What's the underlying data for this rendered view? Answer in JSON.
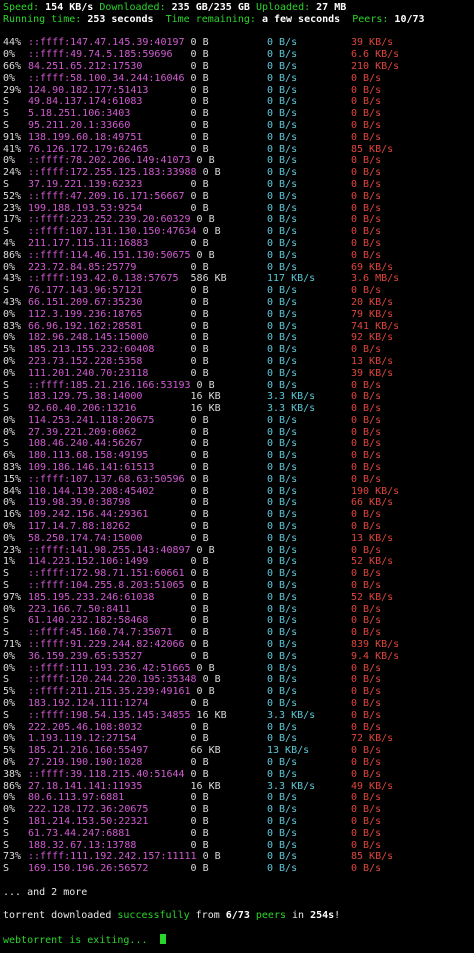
{
  "status": {
    "speed_label": "Speed:",
    "speed_value": "154 KB/s",
    "downloaded_label": "Downloaded:",
    "downloaded_value": "235 GB/235 GB",
    "uploaded_label": "Uploaded:",
    "uploaded_value": "27 MB",
    "running_label": "Running time:",
    "running_value": "253 seconds",
    "remaining_label": "Time remaining:",
    "remaining_value": "a few seconds",
    "peers_label": "Peers:",
    "peers_value": "10/73"
  },
  "peers": [
    {
      "progress": "44%",
      "address": "::ffff:147.47.145.39:40197",
      "downloaded": "0 B",
      "down_speed": "0 B/s",
      "up_speed": "39 KB/s"
    },
    {
      "progress": "0%",
      "address": "::ffff:49.74.5.185:59696",
      "downloaded": "0 B",
      "down_speed": "0 B/s",
      "up_speed": "6.6 KB/s"
    },
    {
      "progress": "66%",
      "address": "84.251.65.212:17530",
      "downloaded": "0 B",
      "down_speed": "0 B/s",
      "up_speed": "210 KB/s"
    },
    {
      "progress": "0%",
      "address": "::ffff:58.100.34.244:16046",
      "downloaded": "0 B",
      "down_speed": "0 B/s",
      "up_speed": "0 B/s"
    },
    {
      "progress": "29%",
      "address": "124.90.182.177:51413",
      "downloaded": "0 B",
      "down_speed": "0 B/s",
      "up_speed": "0 B/s"
    },
    {
      "progress": "S",
      "address": "49.84.137.174:61083",
      "downloaded": "0 B",
      "down_speed": "0 B/s",
      "up_speed": "0 B/s"
    },
    {
      "progress": "S",
      "address": "5.18.251.106:3403",
      "downloaded": "0 B",
      "down_speed": "0 B/s",
      "up_speed": "0 B/s"
    },
    {
      "progress": "S",
      "address": "95.211.20.1:33660",
      "downloaded": "0 B",
      "down_speed": "0 B/s",
      "up_speed": "0 B/s"
    },
    {
      "progress": "91%",
      "address": "138.199.60.18:49751",
      "downloaded": "0 B",
      "down_speed": "0 B/s",
      "up_speed": "0 B/s"
    },
    {
      "progress": "41%",
      "address": "76.126.172.179:62465",
      "downloaded": "0 B",
      "down_speed": "0 B/s",
      "up_speed": "85 KB/s"
    },
    {
      "progress": "0%",
      "address": "::ffff:78.202.206.149:41073",
      "downloaded": "0 B",
      "down_speed": "0 B/s",
      "up_speed": "0 B/s"
    },
    {
      "progress": "24%",
      "address": "::ffff:172.255.125.183:33988",
      "downloaded": "0 B",
      "down_speed": "0 B/s",
      "up_speed": "0 B/s"
    },
    {
      "progress": "S",
      "address": "37.19.221.139:62323",
      "downloaded": "0 B",
      "down_speed": "0 B/s",
      "up_speed": "0 B/s"
    },
    {
      "progress": "52%",
      "address": "::ffff:47.209.16.171:56667",
      "downloaded": "0 B",
      "down_speed": "0 B/s",
      "up_speed": "0 B/s"
    },
    {
      "progress": "23%",
      "address": "199.188.193.53:9254",
      "downloaded": "0 B",
      "down_speed": "0 B/s",
      "up_speed": "0 B/s"
    },
    {
      "progress": "17%",
      "address": "::ffff:223.252.239.20:60329",
      "downloaded": "0 B",
      "down_speed": "0 B/s",
      "up_speed": "0 B/s"
    },
    {
      "progress": "S",
      "address": "::ffff:107.131.130.150:47634",
      "downloaded": "0 B",
      "down_speed": "0 B/s",
      "up_speed": "0 B/s"
    },
    {
      "progress": "4%",
      "address": "211.177.115.11:16883",
      "downloaded": "0 B",
      "down_speed": "0 B/s",
      "up_speed": "0 B/s"
    },
    {
      "progress": "86%",
      "address": "::ffff:114.46.151.130:50675",
      "downloaded": "0 B",
      "down_speed": "0 B/s",
      "up_speed": "0 B/s"
    },
    {
      "progress": "0%",
      "address": "223.72.84.85:25779",
      "downloaded": "0 B",
      "down_speed": "0 B/s",
      "up_speed": "69 KB/s"
    },
    {
      "progress": "43%",
      "address": "::ffff:193.42.0.138:57675",
      "downloaded": "586 KB",
      "down_speed": "117 KB/s",
      "up_speed": "3.6 MB/s"
    },
    {
      "progress": "S",
      "address": "76.177.143.96:57121",
      "downloaded": "0 B",
      "down_speed": "0 B/s",
      "up_speed": "0 B/s"
    },
    {
      "progress": "43%",
      "address": "66.151.209.67:35230",
      "downloaded": "0 B",
      "down_speed": "0 B/s",
      "up_speed": "20 KB/s"
    },
    {
      "progress": "0%",
      "address": "112.3.199.236:18765",
      "downloaded": "0 B",
      "down_speed": "0 B/s",
      "up_speed": "79 KB/s"
    },
    {
      "progress": "83%",
      "address": "66.96.192.162:28581",
      "downloaded": "0 B",
      "down_speed": "0 B/s",
      "up_speed": "741 KB/s"
    },
    {
      "progress": "0%",
      "address": "182.96.248.145:15000",
      "downloaded": "0 B",
      "down_speed": "0 B/s",
      "up_speed": "92 KB/s"
    },
    {
      "progress": "5%",
      "address": "185.213.155.232:60408",
      "downloaded": "0 B",
      "down_speed": "0 B/s",
      "up_speed": "0 B/s"
    },
    {
      "progress": "0%",
      "address": "223.73.152.228:5358",
      "downloaded": "0 B",
      "down_speed": "0 B/s",
      "up_speed": "13 KB/s"
    },
    {
      "progress": "0%",
      "address": "111.201.240.70:23118",
      "downloaded": "0 B",
      "down_speed": "0 B/s",
      "up_speed": "39 KB/s"
    },
    {
      "progress": "S",
      "address": "::ffff:185.21.216.166:53193",
      "downloaded": "0 B",
      "down_speed": "0 B/s",
      "up_speed": "0 B/s"
    },
    {
      "progress": "S",
      "address": "183.129.75.38:14000",
      "downloaded": "16 KB",
      "down_speed": "3.3 KB/s",
      "up_speed": "0 B/s"
    },
    {
      "progress": "S",
      "address": "92.60.40.206:13216",
      "downloaded": "16 KB",
      "down_speed": "3.3 KB/s",
      "up_speed": "0 B/s"
    },
    {
      "progress": "0%",
      "address": "114.253.241.118:20675",
      "downloaded": "0 B",
      "down_speed": "0 B/s",
      "up_speed": "0 B/s"
    },
    {
      "progress": "0%",
      "address": "27.39.221.209:6062",
      "downloaded": "0 B",
      "down_speed": "0 B/s",
      "up_speed": "0 B/s"
    },
    {
      "progress": "S",
      "address": "108.46.240.44:56267",
      "downloaded": "0 B",
      "down_speed": "0 B/s",
      "up_speed": "0 B/s"
    },
    {
      "progress": "6%",
      "address": "180.113.68.158:49195",
      "downloaded": "0 B",
      "down_speed": "0 B/s",
      "up_speed": "0 B/s"
    },
    {
      "progress": "83%",
      "address": "109.186.146.141:61513",
      "downloaded": "0 B",
      "down_speed": "0 B/s",
      "up_speed": "0 B/s"
    },
    {
      "progress": "15%",
      "address": "::ffff:107.137.68.63:50596",
      "downloaded": "0 B",
      "down_speed": "0 B/s",
      "up_speed": "0 B/s"
    },
    {
      "progress": "84%",
      "address": "110.144.139.208:45402",
      "downloaded": "0 B",
      "down_speed": "0 B/s",
      "up_speed": "190 KB/s"
    },
    {
      "progress": "0%",
      "address": "119.98.39.0:38798",
      "downloaded": "0 B",
      "down_speed": "0 B/s",
      "up_speed": "66 KB/s"
    },
    {
      "progress": "16%",
      "address": "109.242.156.44:29361",
      "downloaded": "0 B",
      "down_speed": "0 B/s",
      "up_speed": "0 B/s"
    },
    {
      "progress": "0%",
      "address": "117.14.7.88:18262",
      "downloaded": "0 B",
      "down_speed": "0 B/s",
      "up_speed": "0 B/s"
    },
    {
      "progress": "0%",
      "address": "58.250.174.74:15000",
      "downloaded": "0 B",
      "down_speed": "0 B/s",
      "up_speed": "13 KB/s"
    },
    {
      "progress": "23%",
      "address": "::ffff:141.98.255.143:40897",
      "downloaded": "0 B",
      "down_speed": "0 B/s",
      "up_speed": "0 B/s"
    },
    {
      "progress": "1%",
      "address": "114.223.152.106:1499",
      "downloaded": "0 B",
      "down_speed": "0 B/s",
      "up_speed": "52 KB/s"
    },
    {
      "progress": "S",
      "address": "::ffff:172.98.71.151:60661",
      "downloaded": "0 B",
      "down_speed": "0 B/s",
      "up_speed": "0 B/s"
    },
    {
      "progress": "S",
      "address": "::ffff:104.255.8.203:51065",
      "downloaded": "0 B",
      "down_speed": "0 B/s",
      "up_speed": "0 B/s"
    },
    {
      "progress": "97%",
      "address": "185.195.233.246:61038",
      "downloaded": "0 B",
      "down_speed": "0 B/s",
      "up_speed": "52 KB/s"
    },
    {
      "progress": "0%",
      "address": "223.166.7.50:8411",
      "downloaded": "0 B",
      "down_speed": "0 B/s",
      "up_speed": "0 B/s"
    },
    {
      "progress": "S",
      "address": "61.140.232.182:58468",
      "downloaded": "0 B",
      "down_speed": "0 B/s",
      "up_speed": "0 B/s"
    },
    {
      "progress": "S",
      "address": "::ffff:45.160.74.7:35071",
      "downloaded": "0 B",
      "down_speed": "0 B/s",
      "up_speed": "0 B/s"
    },
    {
      "progress": "71%",
      "address": "::ffff:91.229.244.82:42066",
      "downloaded": "0 B",
      "down_speed": "0 B/s",
      "up_speed": "839 KB/s"
    },
    {
      "progress": "0%",
      "address": "36.159.239.65:53527",
      "downloaded": "0 B",
      "down_speed": "0 B/s",
      "up_speed": "9.4 KB/s"
    },
    {
      "progress": "0%",
      "address": "::ffff:111.193.236.42:51665",
      "downloaded": "0 B",
      "down_speed": "0 B/s",
      "up_speed": "0 B/s"
    },
    {
      "progress": "S",
      "address": "::ffff:120.244.220.195:35348",
      "downloaded": "0 B",
      "down_speed": "0 B/s",
      "up_speed": "0 B/s"
    },
    {
      "progress": "5%",
      "address": "::ffff:211.215.35.239:49161",
      "downloaded": "0 B",
      "down_speed": "0 B/s",
      "up_speed": "0 B/s"
    },
    {
      "progress": "0%",
      "address": "183.192.124.111:1274",
      "downloaded": "0 B",
      "down_speed": "0 B/s",
      "up_speed": "0 B/s"
    },
    {
      "progress": "S",
      "address": "::ffff:198.54.135.145:34855",
      "downloaded": "16 KB",
      "down_speed": "3.3 KB/s",
      "up_speed": "0 B/s"
    },
    {
      "progress": "0%",
      "address": "222.205.46.108:8032",
      "downloaded": "0 B",
      "down_speed": "0 B/s",
      "up_speed": "0 B/s"
    },
    {
      "progress": "0%",
      "address": "1.193.119.12:27154",
      "downloaded": "0 B",
      "down_speed": "0 B/s",
      "up_speed": "72 KB/s"
    },
    {
      "progress": "5%",
      "address": "185.21.216.160:55497",
      "downloaded": "66 KB",
      "down_speed": "13 KB/s",
      "up_speed": "0 B/s"
    },
    {
      "progress": "0%",
      "address": "27.219.190.190:1028",
      "downloaded": "0 B",
      "down_speed": "0 B/s",
      "up_speed": "0 B/s"
    },
    {
      "progress": "38%",
      "address": "::ffff:39.118.215.40:51644",
      "downloaded": "0 B",
      "down_speed": "0 B/s",
      "up_speed": "0 B/s"
    },
    {
      "progress": "86%",
      "address": "27.18.141.141:11935",
      "downloaded": "16 KB",
      "down_speed": "3.3 KB/s",
      "up_speed": "49 KB/s"
    },
    {
      "progress": "0%",
      "address": "80.6.113.97:6881",
      "downloaded": "0 B",
      "down_speed": "0 B/s",
      "up_speed": "0 B/s"
    },
    {
      "progress": "0%",
      "address": "222.128.172.36:20675",
      "downloaded": "0 B",
      "down_speed": "0 B/s",
      "up_speed": "0 B/s"
    },
    {
      "progress": "S",
      "address": "181.214.153.50:22321",
      "downloaded": "0 B",
      "down_speed": "0 B/s",
      "up_speed": "0 B/s"
    },
    {
      "progress": "S",
      "address": "61.73.44.247:6881",
      "downloaded": "0 B",
      "down_speed": "0 B/s",
      "up_speed": "0 B/s"
    },
    {
      "progress": "S",
      "address": "188.32.67.13:13788",
      "downloaded": "0 B",
      "down_speed": "0 B/s",
      "up_speed": "0 B/s"
    },
    {
      "progress": "73%",
      "address": "::ffff:111.192.242.157:11111",
      "downloaded": "0 B",
      "down_speed": "0 B/s",
      "up_speed": "85 KB/s"
    },
    {
      "progress": "S",
      "address": "169.150.196.26:56572",
      "downloaded": "0 B",
      "down_speed": "0 B/s",
      "up_speed": "0 B/s"
    }
  ],
  "more_text": "... and 2 more",
  "result": {
    "prefix": "torrent downloaded ",
    "success_word": "successfully",
    "from_word": " from ",
    "peer_count": "6/73",
    "peers_word": " peers",
    "in_word": " in ",
    "duration": "254s",
    "suffix": "!"
  },
  "exit_text": "webtorrent is exiting..."
}
